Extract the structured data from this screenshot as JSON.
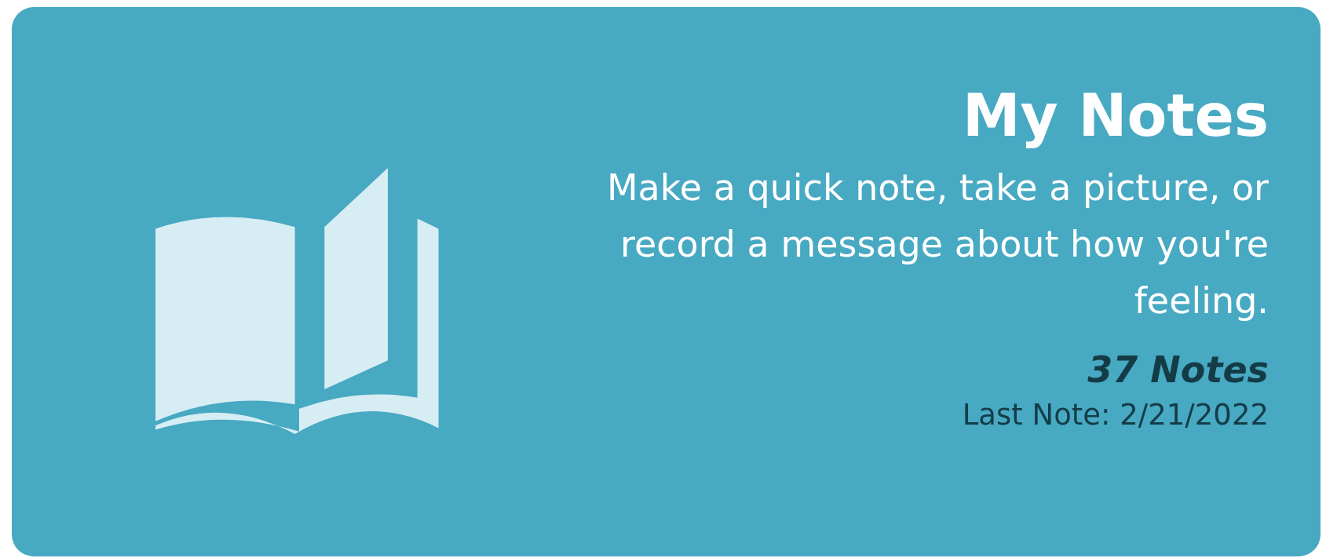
{
  "card": {
    "title": "My Notes",
    "description": "Make a quick note, take a picture, or record a message about how you're feeling.",
    "count": "37 Notes",
    "last_note": "Last Note: 2/21/2022"
  }
}
